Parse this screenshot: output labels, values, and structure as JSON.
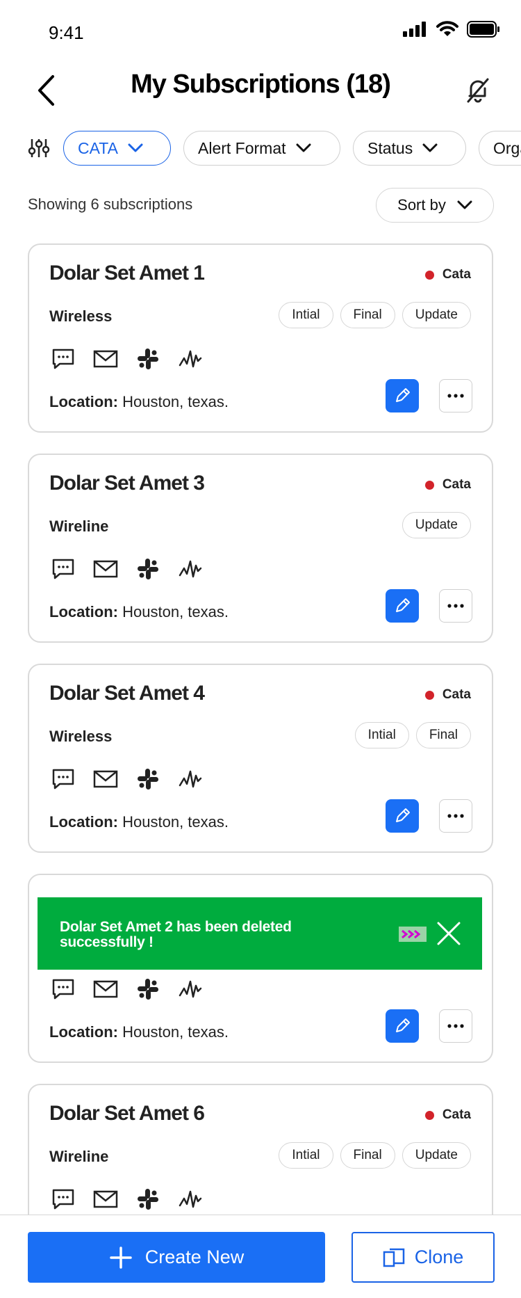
{
  "status_bar": {
    "time": "9:41"
  },
  "header": {
    "title": "My Subscriptions (18)"
  },
  "filters": {
    "chips": [
      {
        "label": "CATA",
        "active": true
      },
      {
        "label": "Alert Format",
        "active": false
      },
      {
        "label": "Status",
        "active": false
      },
      {
        "label": "Orga",
        "active": false
      }
    ]
  },
  "summary": {
    "showing_text": "Showing 6 subscriptions",
    "sort_label": "Sort by"
  },
  "cards": [
    {
      "title": "Dolar Set Amet 1",
      "status": "Cata",
      "type": "Wireless",
      "tags": [
        "Intial",
        "Final",
        "Update"
      ],
      "location_label": "Location:",
      "location_value": "Houston, texas."
    },
    {
      "title": "Dolar Set Amet 3",
      "status": "Cata",
      "type": "Wireline",
      "tags": [
        "Update"
      ],
      "location_label": "Location:",
      "location_value": "Houston, texas."
    },
    {
      "title": "Dolar Set Amet 4",
      "status": "Cata",
      "type": "Wireless",
      "tags": [
        "Intial",
        "Final"
      ],
      "location_label": "Location:",
      "location_value": "Houston, texas."
    },
    {
      "title": "",
      "status": "",
      "type": "",
      "tags": [],
      "location_label": "Location:",
      "location_value": "Houston, texas."
    },
    {
      "title": "Dolar Set Amet 6",
      "status": "Cata",
      "type": "Wireline",
      "tags": [
        "Intial",
        "Final",
        "Update"
      ],
      "location_label": "",
      "location_value": ""
    }
  ],
  "channel_icons": [
    "message-icon",
    "mail-icon",
    "slack-icon",
    "pulse-icon"
  ],
  "toast": {
    "message": "Dolar Set Amet 2  has been deleted successfully !"
  },
  "actions": {
    "create_label": "Create New",
    "clone_label": "Clone"
  },
  "colors": {
    "primary": "#1a6ff5",
    "success": "#00ac3e",
    "status_red": "#d2232a"
  }
}
